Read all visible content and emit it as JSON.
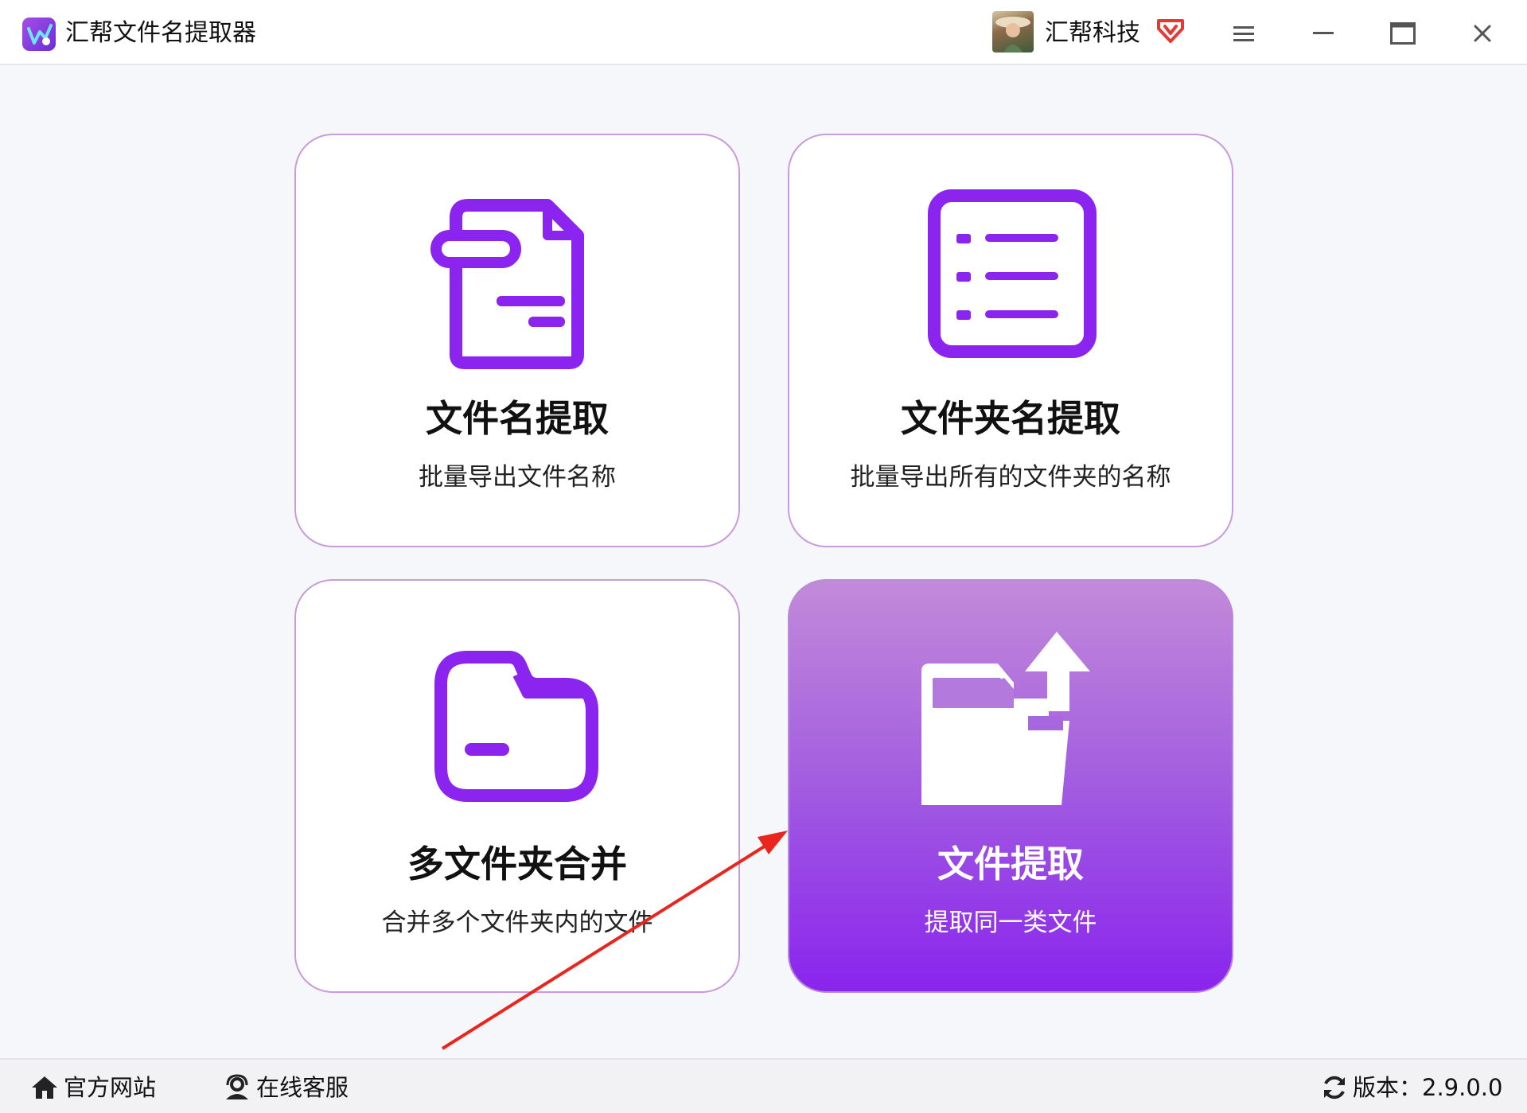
{
  "window": {
    "title": "汇帮文件名提取器",
    "username": "汇帮科技",
    "icons": [
      "app-logo-icon",
      "vip-badge-icon",
      "menu-icon",
      "minimize-icon",
      "maximize-icon",
      "close-icon"
    ]
  },
  "cards": [
    {
      "id": "file-name",
      "title": "文件名提取",
      "desc": "批量导出文件名称",
      "icon": "document-icon",
      "active": false
    },
    {
      "id": "folder-name",
      "title": "文件夹名提取",
      "desc": "批量导出所有的文件夹的名称",
      "icon": "list-icon",
      "active": false
    },
    {
      "id": "merge",
      "title": "多文件夹合并",
      "desc": "合并多个文件夹内的文件",
      "icon": "folder-icon",
      "active": false
    },
    {
      "id": "extract",
      "title": "文件提取",
      "desc": "提取同一类文件",
      "icon": "folder-export-icon",
      "active": true
    }
  ],
  "statusbar": {
    "website": "官方网站",
    "service": "在线客服",
    "version": "版本：2.9.0.0"
  },
  "colors": {
    "accent": "#8a24ee",
    "card_border": "#c79bdc",
    "annotation_arrow": "#e8261e",
    "vip_badge": "#e53935"
  }
}
